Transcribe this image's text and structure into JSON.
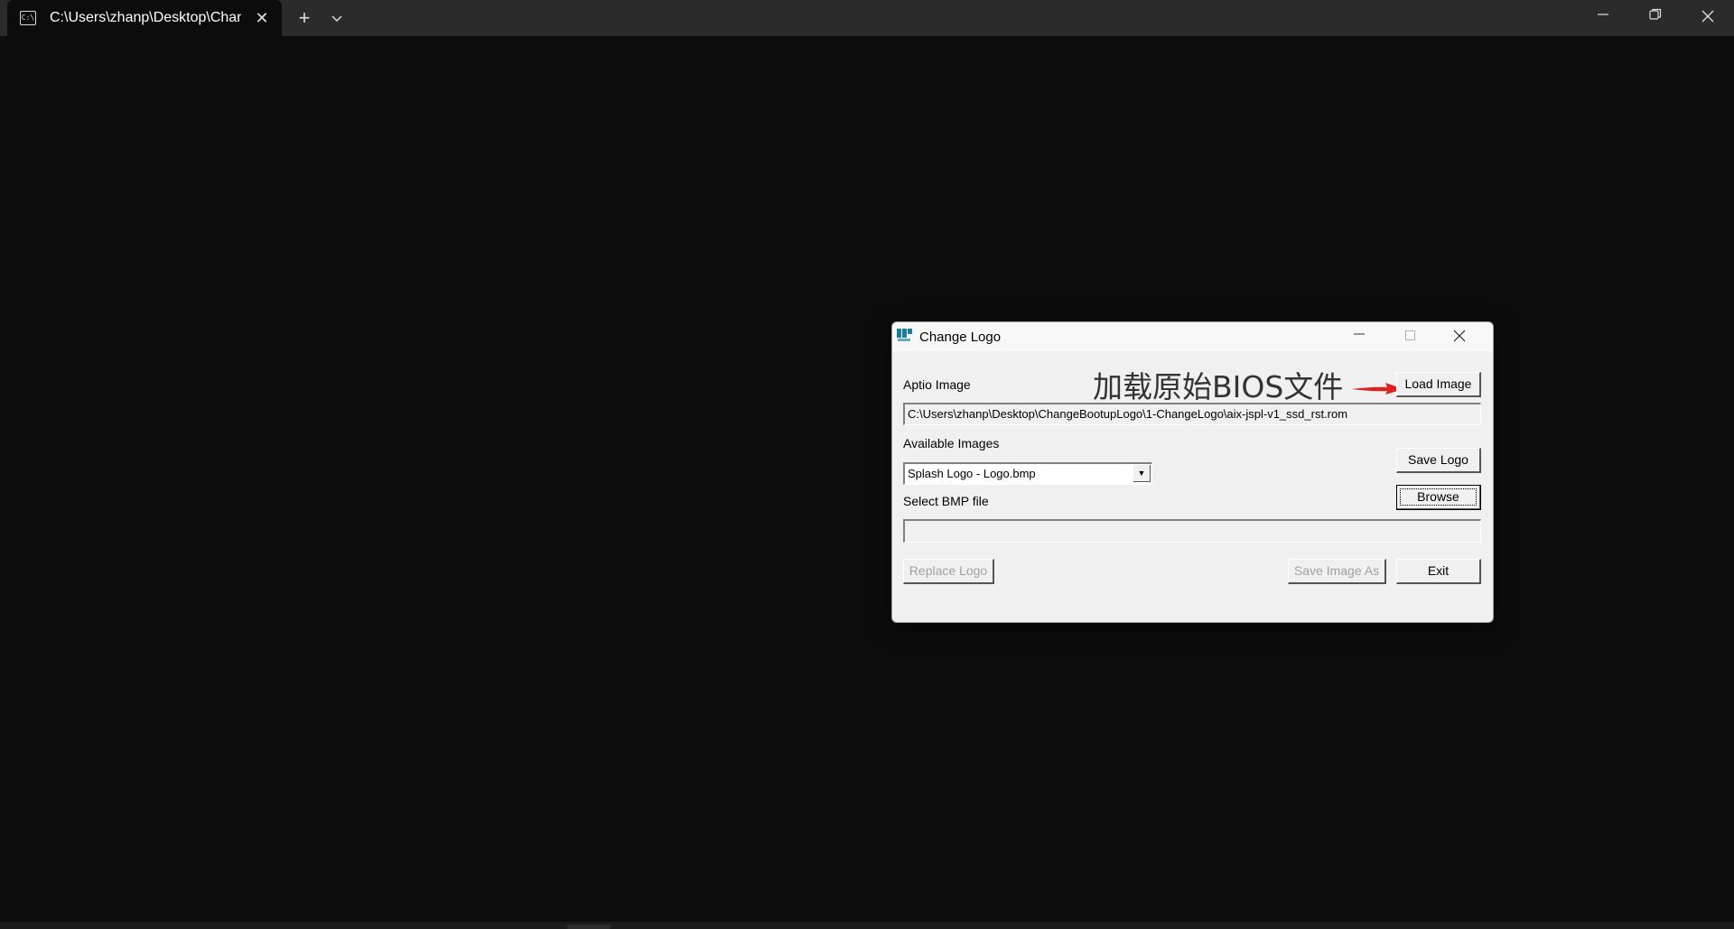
{
  "terminal": {
    "tab_title": "C:\\Users\\zhanp\\Desktop\\Chan",
    "tab_icon": "terminal-icon",
    "new_tab_glyph": "+",
    "dropdown_glyph": "⌄"
  },
  "window_controls": {
    "minimize": "—",
    "maximize": "❐",
    "close": "✕"
  },
  "dialog": {
    "title": "Change Logo",
    "aptio_label": "Aptio Image",
    "aptio_path": "C:\\Users\\zhanp\\Desktop\\ChangeBootupLogo\\1-ChangeLogo\\aix-jspl-v1_ssd_rst.rom",
    "load_image_button": "Load Image",
    "available_label": "Available Images",
    "available_selected": "Splash Logo - Logo.bmp",
    "save_logo_button": "Save Logo",
    "browse_button": "Browse",
    "select_bmp_label": "Select BMP file",
    "bmp_path": "",
    "replace_logo_button": "Replace Logo",
    "save_image_as_button": "Save Image As",
    "exit_button": "Exit",
    "annotation": "加载原始BIOS文件",
    "annotation_color": "#e0201c"
  }
}
